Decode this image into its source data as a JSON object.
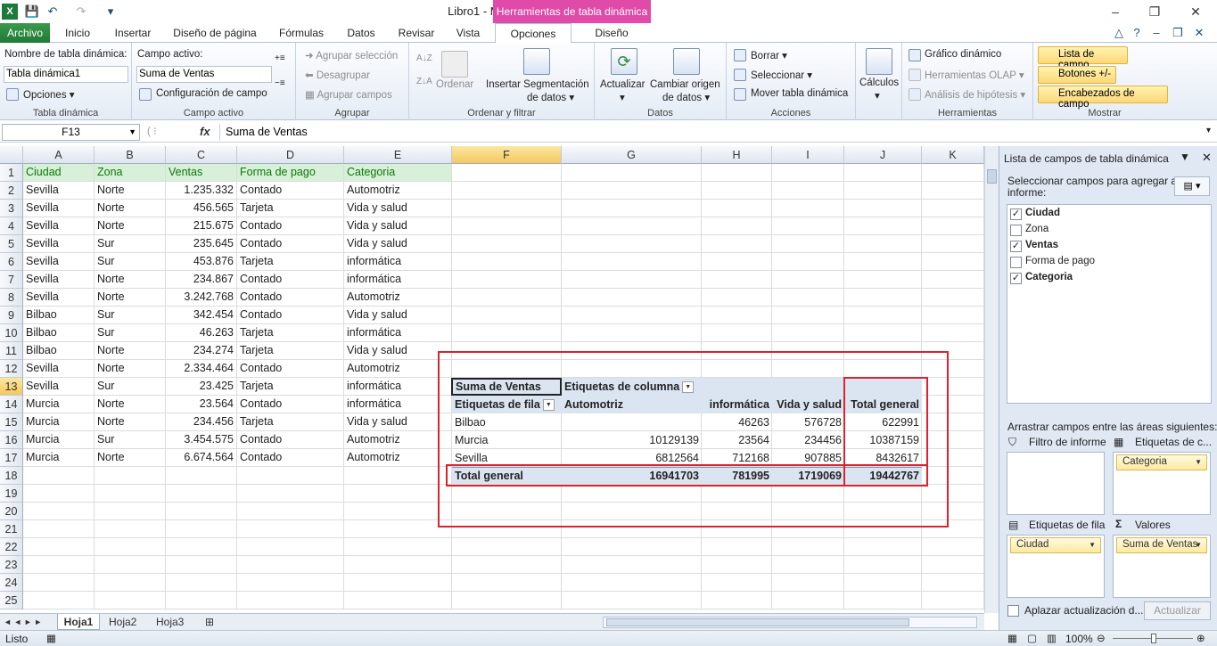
{
  "window": {
    "title": "Libro1  -  Microsoft Excel",
    "context_tab": "Herramientas de tabla dinámica"
  },
  "tabs": [
    "Archivo",
    "Inicio",
    "Insertar",
    "Diseño de página",
    "Fórmulas",
    "Datos",
    "Revisar",
    "Vista",
    "Opciones",
    "Diseño"
  ],
  "ribbon": {
    "tabla_dinamica": {
      "name_label": "Nombre de tabla dinámica:",
      "name_value": "Tabla dinámica1",
      "options": "Opciones",
      "group": "Tabla dinámica"
    },
    "campo_activo": {
      "label": "Campo activo:",
      "value": "Suma de Ventas",
      "config": "Configuración de campo",
      "group": "Campo activo"
    },
    "agrupar": {
      "items": [
        "Agrupar selección",
        "Desagrupar",
        "Agrupar campos"
      ],
      "group": "Agrupar"
    },
    "ordenar": {
      "ordenar": "Ordenar",
      "insertar_seg_1": "Insertar Segmentación",
      "insertar_seg_2": "de datos",
      "group": "Ordenar y filtrar"
    },
    "datos": {
      "actualizar": "Actualizar",
      "cambiar_1": "Cambiar origen",
      "cambiar_2": "de datos",
      "group": "Datos"
    },
    "acciones": {
      "items": [
        "Borrar",
        "Seleccionar",
        "Mover tabla dinámica"
      ],
      "group": "Acciones"
    },
    "calculos": "Cálculos",
    "herramientas": {
      "items": [
        "Gráfico dinámico",
        "Herramientas OLAP",
        "Análisis de hipótesis"
      ],
      "group": "Herramientas"
    },
    "mostrar": {
      "items": [
        "Lista de campo",
        "Botones +/-",
        "Encabezados de campo"
      ],
      "group": "Mostrar"
    }
  },
  "formula_bar": {
    "name_box": "F13",
    "fx": "fx",
    "content": "Suma de Ventas"
  },
  "columns": [
    "A",
    "B",
    "C",
    "D",
    "E",
    "F",
    "G",
    "H",
    "I",
    "J",
    "K"
  ],
  "rows": [
    "1",
    "2",
    "3",
    "4",
    "5",
    "6",
    "7",
    "8",
    "9",
    "10",
    "11",
    "12",
    "13",
    "14",
    "15",
    "16",
    "17",
    "18",
    "19",
    "20",
    "21",
    "22",
    "23",
    "24",
    "25"
  ],
  "table": {
    "headers": [
      "Ciudad",
      "Zona",
      "Ventas",
      "Forma de pago",
      "Categoria"
    ],
    "rows": [
      [
        "Sevilla",
        "Norte",
        "1.235.332",
        "Contado",
        "Automotriz"
      ],
      [
        "Sevilla",
        "Norte",
        "456.565",
        "Tarjeta",
        "Vida y salud"
      ],
      [
        "Sevilla",
        "Norte",
        "215.675",
        "Contado",
        "Vida y salud"
      ],
      [
        "Sevilla",
        "Sur",
        "235.645",
        "Contado",
        "Vida y salud"
      ],
      [
        "Sevilla",
        "Sur",
        "453.876",
        "Tarjeta",
        "informática"
      ],
      [
        "Sevilla",
        "Norte",
        "234.867",
        "Contado",
        "informática"
      ],
      [
        "Sevilla",
        "Norte",
        "3.242.768",
        "Contado",
        "Automotriz"
      ],
      [
        "Bilbao",
        "Sur",
        "342.454",
        "Contado",
        "Vida y salud"
      ],
      [
        "Bilbao",
        "Sur",
        "46.263",
        "Tarjeta",
        "informática"
      ],
      [
        "Bilbao",
        "Norte",
        "234.274",
        "Tarjeta",
        "Vida y salud"
      ],
      [
        "Sevilla",
        "Norte",
        "2.334.464",
        "Contado",
        "Automotriz"
      ],
      [
        "Sevilla",
        "Sur",
        "23.425",
        "Tarjeta",
        "informática"
      ],
      [
        "Murcia",
        "Norte",
        "23.564",
        "Contado",
        "informática"
      ],
      [
        "Murcia",
        "Norte",
        "234.456",
        "Tarjeta",
        "Vida y salud"
      ],
      [
        "Murcia",
        "Sur",
        "3.454.575",
        "Contado",
        "Automotriz"
      ],
      [
        "Murcia",
        "Norte",
        "6.674.564",
        "Contado",
        "Automotriz"
      ]
    ]
  },
  "pivot": {
    "value_label": "Suma de Ventas",
    "col_labels": "Etiquetas de columna",
    "row_labels": "Etiquetas de fila",
    "columns": [
      "Automotriz",
      "informática",
      "Vida y salud",
      "Total general"
    ],
    "rows": [
      {
        "label": "Bilbao",
        "values": [
          "",
          "46263",
          "576728",
          "622991"
        ]
      },
      {
        "label": "Murcia",
        "values": [
          "10129139",
          "23564",
          "234456",
          "10387159"
        ]
      },
      {
        "label": "Sevilla",
        "values": [
          "6812564",
          "712168",
          "907885",
          "8432617"
        ]
      }
    ],
    "total": {
      "label": "Total general",
      "values": [
        "16941703",
        "781995",
        "1719069",
        "19442767"
      ]
    }
  },
  "sheets": [
    "Hoja1",
    "Hoja2",
    "Hoja3"
  ],
  "status": {
    "mode": "Listo",
    "zoom": "100%"
  },
  "field_list": {
    "title": "Lista de campos de tabla dinámica",
    "select_text_1": "Seleccionar campos para agregar al",
    "select_text_2": "informe:",
    "fields": [
      {
        "name": "Ciudad",
        "checked": true
      },
      {
        "name": "Zona",
        "checked": false
      },
      {
        "name": "Ventas",
        "checked": true
      },
      {
        "name": "Forma de pago",
        "checked": false
      },
      {
        "name": "Categoria",
        "checked": true
      }
    ],
    "drag_text": "Arrastrar campos entre las áreas siguientes:",
    "filter_label": "Filtro de informe",
    "col_label": "Etiquetas de c...",
    "row_label": "Etiquetas de fila",
    "values_label": "Valores",
    "col_field": "Categoria",
    "row_field": "Ciudad",
    "value_field": "Suma de Ventas",
    "defer": "Aplazar actualización d...",
    "update": "Actualizar"
  }
}
